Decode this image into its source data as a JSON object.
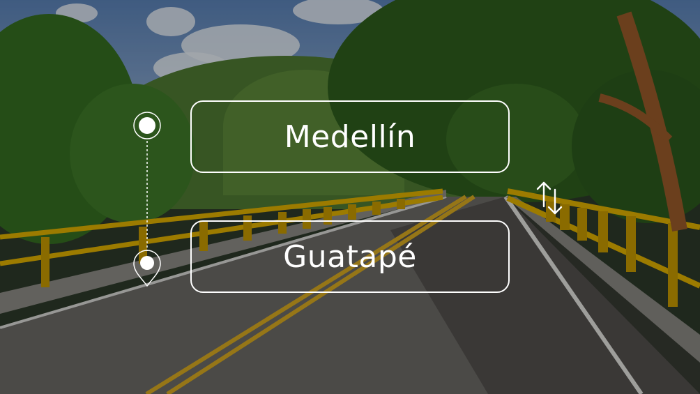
{
  "route": {
    "origin": "Medellín",
    "destination": "Guatapé"
  },
  "icons": {
    "origin_marker": "circle-marker-icon",
    "destination_marker": "location-pin-icon",
    "route_line": "dotted-route-line",
    "swap": "swap-vertical-arrows-icon"
  },
  "colors": {
    "text": "#ffffff",
    "border": "#ffffff",
    "railing": "#e0b000"
  }
}
